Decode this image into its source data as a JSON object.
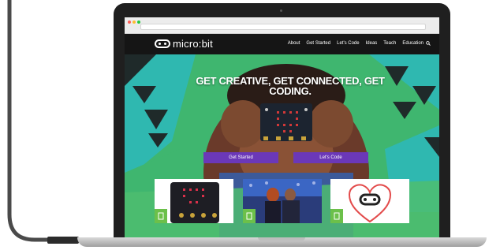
{
  "colors": {
    "nav_bg": "#151515",
    "hero_green": "#3fb66f",
    "hero_teal": "#2fb8b0",
    "triangle_dark": "#1f2a2a",
    "button_purple": "#6b38b8",
    "tile_green": "#6cc04a"
  },
  "site": {
    "logo_text": "micro:bit",
    "nav_items": [
      "About",
      "Get Started",
      "Let's Code",
      "Ideas",
      "Teach",
      "Education"
    ],
    "search_icon": "search-icon"
  },
  "hero": {
    "title": "GET CREATIVE, GET CONNECTED, GET CODING.",
    "buttons": [
      "Get Started",
      "Let's Code"
    ]
  },
  "cards": [
    {
      "image": "micro:bit board with LED grid"
    },
    {
      "image": "presenters on stage"
    },
    {
      "image": "heart outline with micro:bit"
    }
  ]
}
